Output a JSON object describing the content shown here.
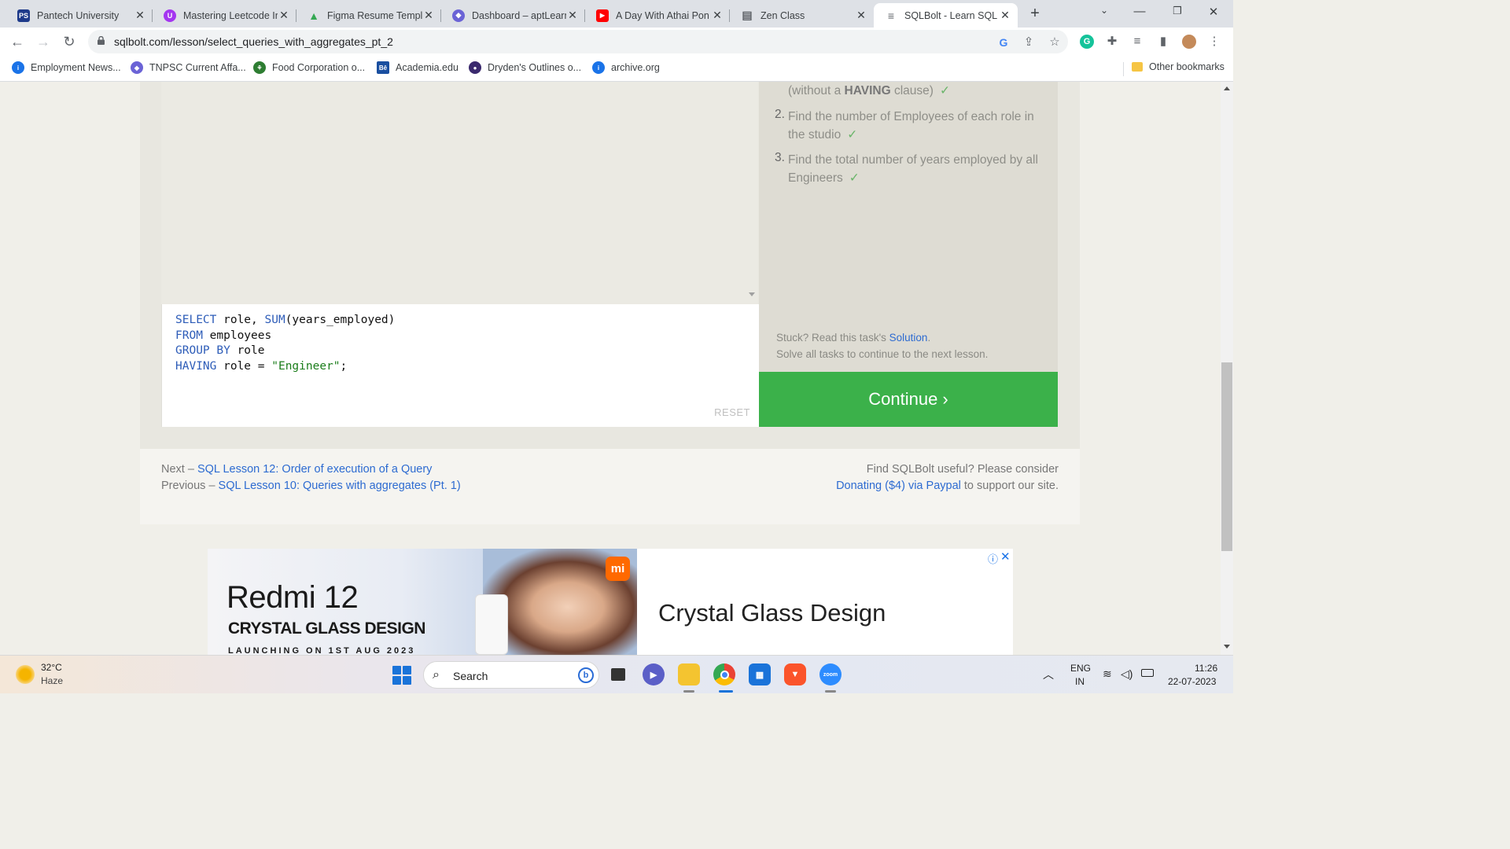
{
  "browser": {
    "tabs": [
      {
        "title": "Pantech University",
        "favicon_text": "PS",
        "favicon_color": "#1e3a8a",
        "active": false
      },
      {
        "title": "Mastering Leetcode Ir",
        "favicon_text": "U",
        "favicon_color": "#a435f0",
        "active": false
      },
      {
        "title": "Figma Resume Templ",
        "favicon_text": "▲",
        "favicon_color": "#34a853",
        "active": false
      },
      {
        "title": "Dashboard – aptLearn",
        "favicon_text": "◆",
        "favicon_color": "#6b63d6",
        "active": false
      },
      {
        "title": "A Day With Athai Pon",
        "favicon_text": "▶",
        "favicon_color": "#ff0000",
        "active": false
      },
      {
        "title": "Zen Class",
        "favicon_text": "▤",
        "favicon_color": "#5f6368",
        "active": false
      },
      {
        "title": "SQLBolt - Learn SQL -",
        "favicon_text": "≡",
        "favicon_color": "#5f6368",
        "active": true
      }
    ],
    "url": "sqlbolt.com/lesson/select_queries_with_aggregates_pt_2",
    "bookmarks": [
      {
        "label": "Employment News...",
        "icon_color": "#1a73e8",
        "icon_text": "i"
      },
      {
        "label": "TNPSC Current Affa...",
        "icon_color": "#6b63d6",
        "icon_text": "◆"
      },
      {
        "label": "Food Corporation o...",
        "icon_color": "#2e7d32",
        "icon_text": "⚘"
      },
      {
        "label": "Academia.edu",
        "icon_color": "#1a4fa0",
        "icon_text": "Bê"
      },
      {
        "label": "Dryden's Outlines o...",
        "icon_color": "#3b2a6e",
        "icon_text": "●"
      },
      {
        "label": "archive.org",
        "icon_color": "#1a73e8",
        "icon_text": "i"
      }
    ],
    "other_bookmarks": "Other bookmarks"
  },
  "lesson": {
    "code_lines": [
      [
        {
          "t": "SELECT",
          "k": "kw"
        },
        {
          "t": " role, ",
          "k": ""
        },
        {
          "t": "SUM",
          "k": "kw"
        },
        {
          "t": "(years_employed)",
          "k": ""
        }
      ],
      [
        {
          "t": "FROM",
          "k": "kw"
        },
        {
          "t": " employees",
          "k": ""
        }
      ],
      [
        {
          "t": "GROUP BY",
          "k": "kw"
        },
        {
          "t": " role",
          "k": ""
        }
      ],
      [
        {
          "t": "HAVING",
          "k": "kw"
        },
        {
          "t": " role = ",
          "k": ""
        },
        {
          "t": "\"Engineer\"",
          "k": "str"
        },
        {
          "t": ";",
          "k": ""
        }
      ]
    ],
    "reset_label": "RESET",
    "tasks": {
      "partial_prefix": "(without a ",
      "partial_bold": "HAVING",
      "partial_suffix": " clause)",
      "task2_num": "2.",
      "task2_line1": "Find the number of Employees of each role in",
      "task2_line2": "the studio",
      "task3_num": "3.",
      "task3_line1": "Find the total number of years employed by all",
      "task3_line2": "Engineers",
      "check": "✓"
    },
    "stuck_prefix": "Stuck? Read this task's ",
    "stuck_link": "Solution",
    "stuck_suffix": ".",
    "solve_all": "Solve all tasks to continue to the next lesson.",
    "continue_label": "Continue ›",
    "next_prefix": "Next – ",
    "next_link": "SQL Lesson 12: Order of execution of a Query",
    "prev_prefix": "Previous – ",
    "prev_link": "SQL Lesson 10: Queries with aggregates (Pt. 1)",
    "donate_line1": "Find SQLBolt useful? Please consider",
    "donate_link": "Donating ($4) via Paypal",
    "donate_suffix": " to support our site."
  },
  "ad": {
    "model": "Redmi 12",
    "tagline": "CRYSTAL GLASS DESIGN",
    "launch": "LAUNCHING ON 1ST AUG 2023",
    "brand_mark": "mi",
    "headline": "Crystal Glass Design",
    "info_icon": "ⓘ",
    "close_icon": "✕"
  },
  "taskbar": {
    "temperature": "32°C",
    "condition": "Haze",
    "search_label": "Search",
    "lang_line1": "ENG",
    "lang_line2": "IN",
    "time": "11:26",
    "date": "22-07-2023"
  }
}
